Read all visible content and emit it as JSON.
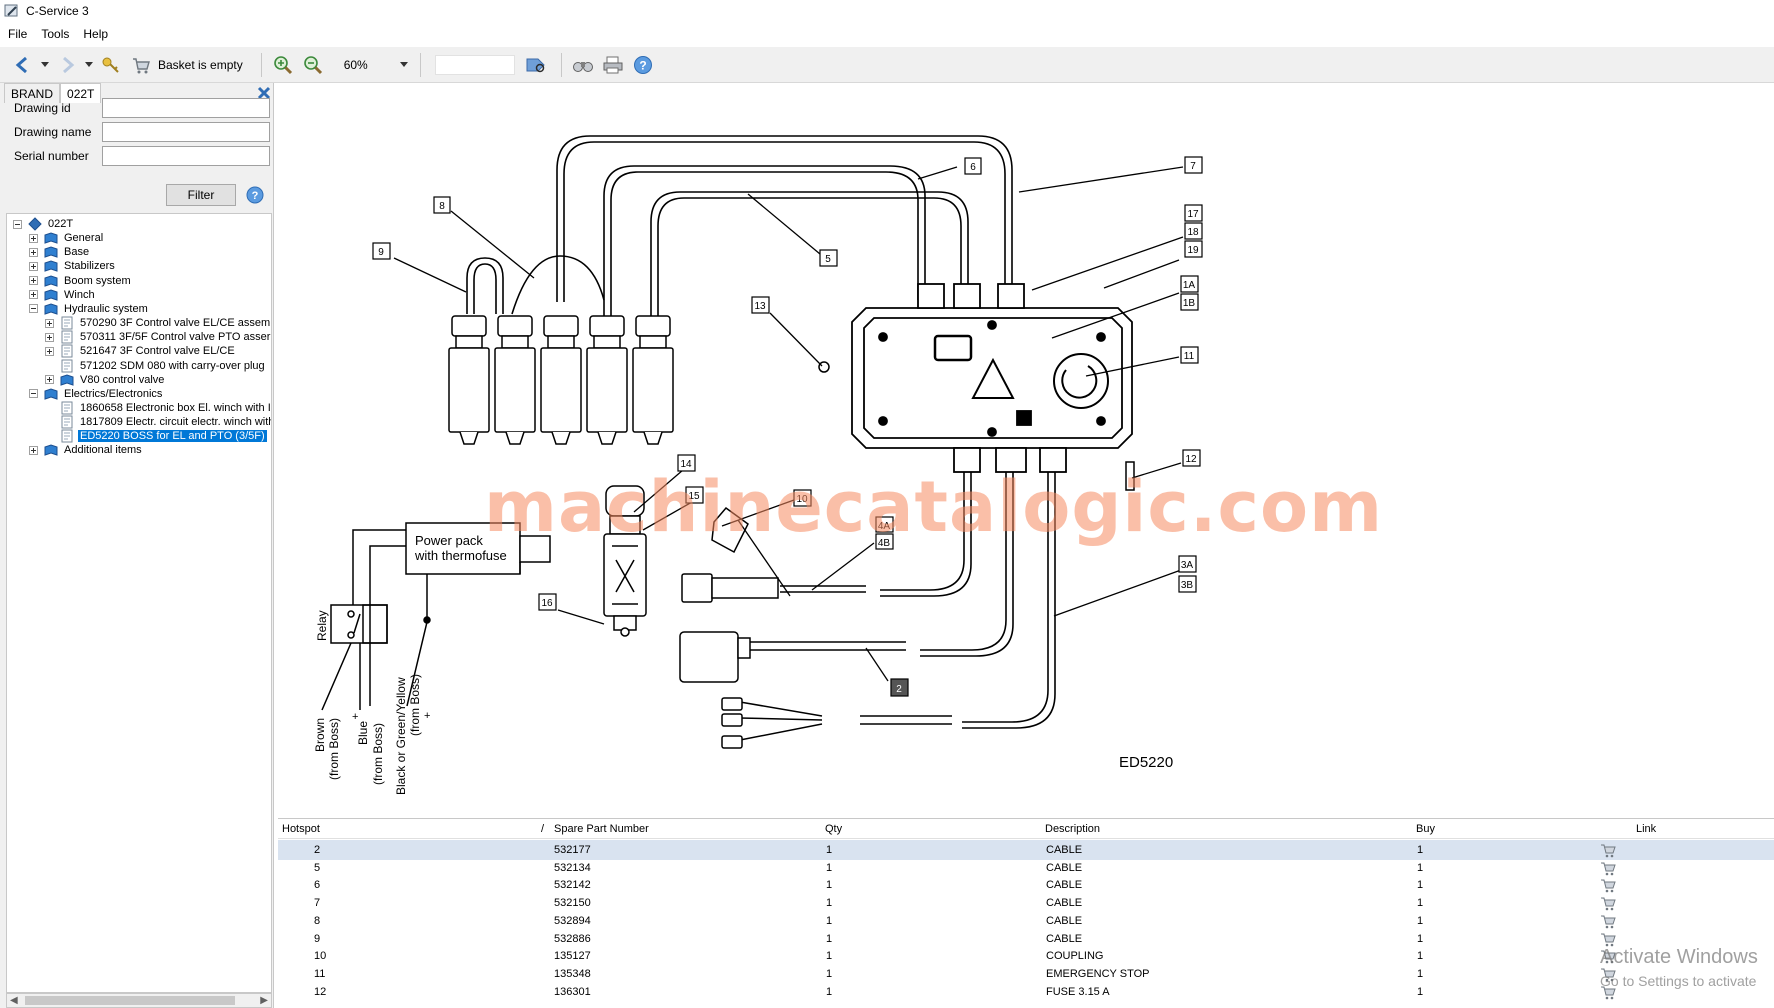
{
  "window": {
    "title": "C-Service 3"
  },
  "menu": [
    "File",
    "Tools",
    "Help"
  ],
  "toolbar": {
    "basket_label": "Basket is empty",
    "zoom_value": "60%"
  },
  "tabs": [
    "BRAND",
    "022T"
  ],
  "search_form": {
    "drawing_id_label": "Drawing id",
    "drawing_name_label": "Drawing name",
    "serial_number_label": "Serial number",
    "filter_label": "Filter"
  },
  "tree": [
    {
      "label": "022T",
      "level": 0,
      "expander": "minus",
      "icon": "folder-icon"
    },
    {
      "label": "General",
      "level": 1,
      "expander": "plus",
      "icon": "book-icon"
    },
    {
      "label": "Base",
      "level": 1,
      "expander": "plus",
      "icon": "book-icon"
    },
    {
      "label": "Stabilizers",
      "level": 1,
      "expander": "plus",
      "icon": "book-icon"
    },
    {
      "label": "Boom system",
      "level": 1,
      "expander": "plus",
      "icon": "book-icon"
    },
    {
      "label": "Winch",
      "level": 1,
      "expander": "plus",
      "icon": "book-icon"
    },
    {
      "label": "Hydraulic system",
      "level": 1,
      "expander": "minus",
      "icon": "book-icon"
    },
    {
      "label": "570290 3F Control valve EL/CE assem",
      "level": 2,
      "expander": "plus",
      "icon": "page-icon"
    },
    {
      "label": "570311 3F/5F Control valve PTO asser",
      "level": 2,
      "expander": "plus",
      "icon": "page-icon"
    },
    {
      "label": "521647 3F Control valve EL/CE",
      "level": 2,
      "expander": "plus",
      "icon": "page-icon"
    },
    {
      "label": "571202 SDM 080 with carry-over plug",
      "level": 2,
      "expander": "none",
      "icon": "page-icon"
    },
    {
      "label": "V80 control valve",
      "level": 2,
      "expander": "plus",
      "icon": "book-icon"
    },
    {
      "label": "Electrics/Electronics",
      "level": 1,
      "expander": "minus",
      "icon": "book-icon"
    },
    {
      "label": "1860658 Electronic box El. winch with I",
      "level": 2,
      "expander": "none",
      "icon": "page-icon"
    },
    {
      "label": "1817809 Electr. circuit electr. winch with",
      "level": 2,
      "expander": "none",
      "icon": "page-icon"
    },
    {
      "label": "ED5220 BOSS for EL and PTO (3/5F)",
      "level": 2,
      "expander": "none",
      "icon": "page-icon",
      "selected": true
    },
    {
      "label": "Additional items",
      "level": 1,
      "expander": "plus",
      "icon": "book-icon"
    }
  ],
  "drawing": {
    "id_label": "ED5220",
    "power_pack_line1": "Power pack",
    "power_pack_line2": "with thermofuse",
    "relay_label": "Relay",
    "wire_brown_1": "Brown",
    "wire_brown_2": "(from Boss)",
    "wire_blue_1": "Blue",
    "wire_blue_2": "(from Boss)",
    "wire_black_1": "Black or Green/Yellow",
    "wire_black_2": "(from Boss)",
    "plus_sign": "+",
    "callouts": {
      "c2": "2",
      "c3a": "3A",
      "c3b": "3B",
      "c4a": "4A",
      "c4b": "4B",
      "c5": "5",
      "c6": "6",
      "c7": "7",
      "c8": "8",
      "c9": "9",
      "c10": "10",
      "c11": "11",
      "c12": "12",
      "c13": "13",
      "c14": "14",
      "c15": "15",
      "c16": "16",
      "c17": "17",
      "c18": "18",
      "c19": "19",
      "c1a": "1A",
      "c1b": "1B"
    }
  },
  "table": {
    "columns": {
      "hotspot": "Hotspot",
      "sort_mark": "/",
      "part": "Spare Part Number",
      "qty": "Qty",
      "desc": "Description",
      "buy": "Buy",
      "link": "Link"
    },
    "rows": [
      {
        "hotspot": "2",
        "part": "532177",
        "qty": "1",
        "desc": "CABLE",
        "buy": "1",
        "selected": true
      },
      {
        "hotspot": "5",
        "part": "532134",
        "qty": "1",
        "desc": "CABLE",
        "buy": "1"
      },
      {
        "hotspot": "6",
        "part": "532142",
        "qty": "1",
        "desc": "CABLE",
        "buy": "1"
      },
      {
        "hotspot": "7",
        "part": "532150",
        "qty": "1",
        "desc": "CABLE",
        "buy": "1"
      },
      {
        "hotspot": "8",
        "part": "532894",
        "qty": "1",
        "desc": "CABLE",
        "buy": "1"
      },
      {
        "hotspot": "9",
        "part": "532886",
        "qty": "1",
        "desc": "CABLE",
        "buy": "1"
      },
      {
        "hotspot": "10",
        "part": "135127",
        "qty": "1",
        "desc": "COUPLING",
        "buy": "1"
      },
      {
        "hotspot": "11",
        "part": "135348",
        "qty": "1",
        "desc": "EMERGENCY STOP",
        "buy": "1"
      },
      {
        "hotspot": "12",
        "part": "136301",
        "qty": "1",
        "desc": "FUSE 3.15 A",
        "buy": "1"
      }
    ]
  },
  "overlays": {
    "watermark": "machinecatalogic.com",
    "activate_line1": "Activate Windows",
    "activate_line2": "Go to Settings to activate"
  }
}
